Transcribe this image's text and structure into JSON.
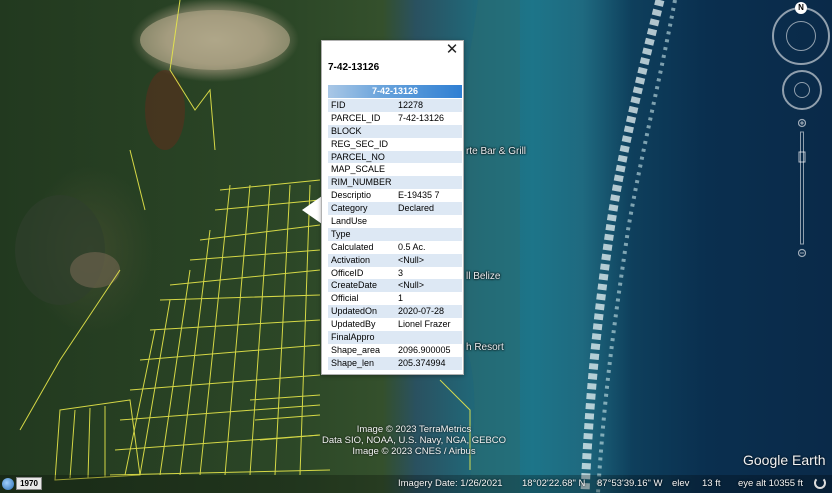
{
  "map": {
    "place_labels": [
      "rte Bar & Grill",
      "ll Belize",
      "h Resort"
    ]
  },
  "popup": {
    "title": "7-42-13126",
    "header": "7-42-13126",
    "close_glyph": "✕",
    "rows": [
      {
        "key": "FID",
        "value": "12278"
      },
      {
        "key": "PARCEL_ID",
        "value": "7-42-13126"
      },
      {
        "key": "BLOCK",
        "value": ""
      },
      {
        "key": "REG_SEC_ID",
        "value": ""
      },
      {
        "key": "PARCEL_NO",
        "value": ""
      },
      {
        "key": "MAP_SCALE",
        "value": ""
      },
      {
        "key": "RIM_NUMBER",
        "value": ""
      },
      {
        "key": "Descriptio",
        "value": "E-19435 7"
      },
      {
        "key": "Category",
        "value": "Declared"
      },
      {
        "key": "LandUse",
        "value": ""
      },
      {
        "key": "Type",
        "value": ""
      },
      {
        "key": "Calculated",
        "value": "0.5 Ac."
      },
      {
        "key": "Activation",
        "value": "<Null>"
      },
      {
        "key": "OfficeID",
        "value": "3"
      },
      {
        "key": "CreateDate",
        "value": "<Null>"
      },
      {
        "key": "Official",
        "value": "1"
      },
      {
        "key": "UpdatedOn",
        "value": "2020-07-28"
      },
      {
        "key": "UpdatedBy",
        "value": "Lionel Frazer"
      },
      {
        "key": "FinalAppro",
        "value": ""
      },
      {
        "key": "Shape_area",
        "value": "2096.900005"
      },
      {
        "key": "Shape_len",
        "value": "205.374994"
      }
    ]
  },
  "navigation": {
    "compass_letter": "N"
  },
  "attribution": {
    "line1": "Image © 2023 TerraMetrics",
    "line2": "Data SIO, NOAA, U.S. Navy, NGA, GEBCO",
    "line3": "Image © 2023 CNES / Airbus"
  },
  "brand": "Google Earth",
  "status": {
    "year": "1970",
    "imagery_date": "Imagery Date: 1/26/2021",
    "latitude": "18°02'22.68\" N",
    "longitude": "87°53'39.16\" W",
    "elev_label": "elev",
    "elev_value": "13 ft",
    "eye_alt": "eye alt  10355 ft"
  },
  "colors": {
    "parcel_lines": "#e8e84a",
    "popup_header": "#2f7fd3",
    "row_alt": "#dde8f4"
  }
}
